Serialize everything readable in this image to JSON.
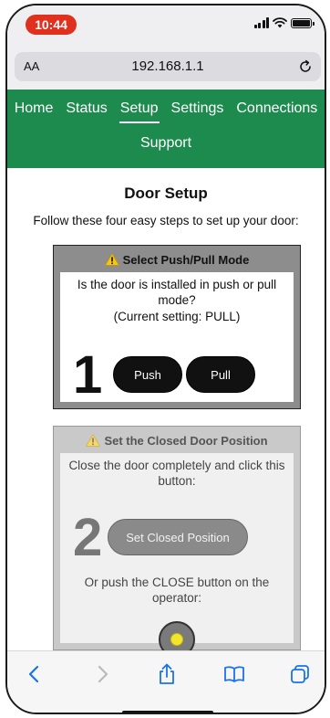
{
  "status_bar": {
    "time": "10:44"
  },
  "browser": {
    "text_size_label": "AA",
    "url": "192.168.1.1"
  },
  "nav": {
    "items": [
      "Home",
      "Status",
      "Setup",
      "Settings",
      "Connections",
      "Support"
    ],
    "active": "Setup"
  },
  "page": {
    "title": "Door Setup",
    "intro": "Follow these four easy steps to set up your door:"
  },
  "step1": {
    "header": "Select Push/Pull Mode",
    "question": "Is the door is installed in push or pull mode?",
    "current": "(Current setting: PULL)",
    "number": "1",
    "push_label": "Push",
    "pull_label": "Pull"
  },
  "step2": {
    "header": "Set the Closed Door Position",
    "instruction": "Close the door completely and click this button:",
    "number": "2",
    "button_label": "Set Closed Position",
    "alt_instruction": "Or push the CLOSE button on the operator:"
  },
  "colors": {
    "nav_green": "#1e8b4e",
    "time_pill_red": "#e0301e",
    "warning_yellow": "#f5c518",
    "operator_led": "#f2e52a",
    "toolbar_blue": "#1a73e8"
  },
  "icons": {
    "toolbar": [
      "back-icon",
      "forward-icon",
      "share-icon",
      "bookmarks-icon",
      "tabs-icon"
    ]
  }
}
